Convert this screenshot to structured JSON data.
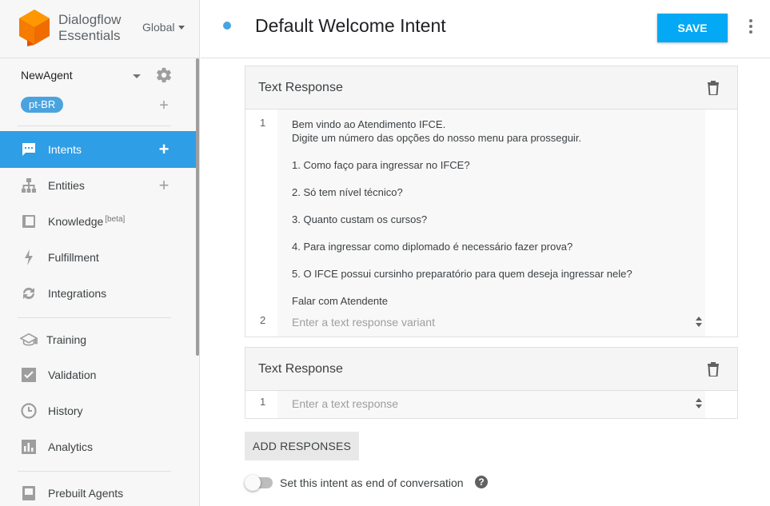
{
  "brand": {
    "line1": "Dialogflow",
    "line2": "Essentials",
    "region": "Global"
  },
  "agent": {
    "name": "NewAgent",
    "language": "pt-BR"
  },
  "nav": {
    "intents": "Intents",
    "entities": "Entities",
    "knowledge": "Knowledge",
    "knowledge_badge": "[beta]",
    "fulfillment": "Fulfillment",
    "integrations": "Integrations",
    "training": "Training",
    "validation": "Validation",
    "history": "History",
    "analytics": "Analytics",
    "prebuilt": "Prebuilt Agents"
  },
  "header": {
    "title": "Default Welcome Intent",
    "save_label": "SAVE"
  },
  "responses": [
    {
      "title": "Text Response",
      "lines": [
        "Bem vindo ao Atendimento IFCE.",
        "Digite um número das opções do nosso menu para prosseguir.",
        "",
        "1. Como faço para ingressar no IFCE?",
        "",
        "2. Só tem nível técnico?",
        "",
        "3. Quanto custam os cursos?",
        "",
        "4. Para ingressar como diplomado é necessário fazer prova?",
        "",
        "5. O IFCE possui cursinho preparatório para quem deseja ingressar nele?",
        "",
        "Falar com Atendente"
      ],
      "row1_num": "1",
      "row2_num": "2",
      "variant_placeholder": "Enter a text response variant"
    },
    {
      "title": "Text Response",
      "row1_num": "1",
      "placeholder": "Enter a text response"
    }
  ],
  "add_responses_label": "ADD RESPONSES",
  "end_conversation_label": "Set this intent as end of conversation",
  "help_glyph": "?",
  "colors": {
    "accent": "#2e9ee6",
    "save": "#03a9f4",
    "badge": "#4aa3df",
    "logo": "#f57c00"
  }
}
